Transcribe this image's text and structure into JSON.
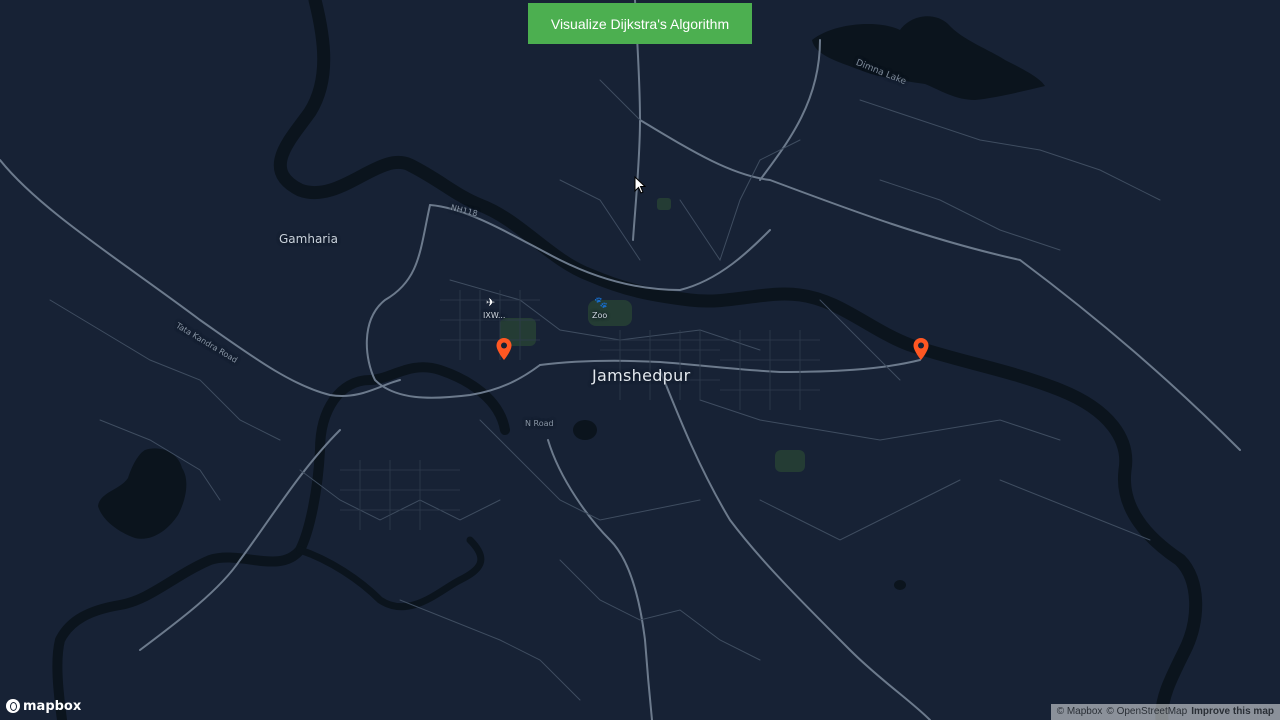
{
  "toolbar": {
    "visualize_label": "Visualize Dijkstra's Algorithm",
    "accent": "#4caf50"
  },
  "map": {
    "background": "#172235",
    "water": "#0b141d",
    "road_color": "#6c7a8c",
    "park_color": "#243c34",
    "marker_color": "#ff5722",
    "labels": {
      "city": "Jamshedpur",
      "town": "Gamharia",
      "lake": "Dimna Lake",
      "highway_1": "NH118",
      "highway_2": "Tata Kandra Road",
      "road": "N Road",
      "airport": "IXW...",
      "zoo": "Zoo"
    },
    "icons": {
      "airport": "airport-icon",
      "zoo": "zoo-icon",
      "marker": "location-pin-icon"
    }
  },
  "footer": {
    "logo_text": "mapbox",
    "attribution_mapbox": "© Mapbox",
    "attribution_osm": "© OpenStreetMap",
    "improve_link": "Improve this map"
  }
}
